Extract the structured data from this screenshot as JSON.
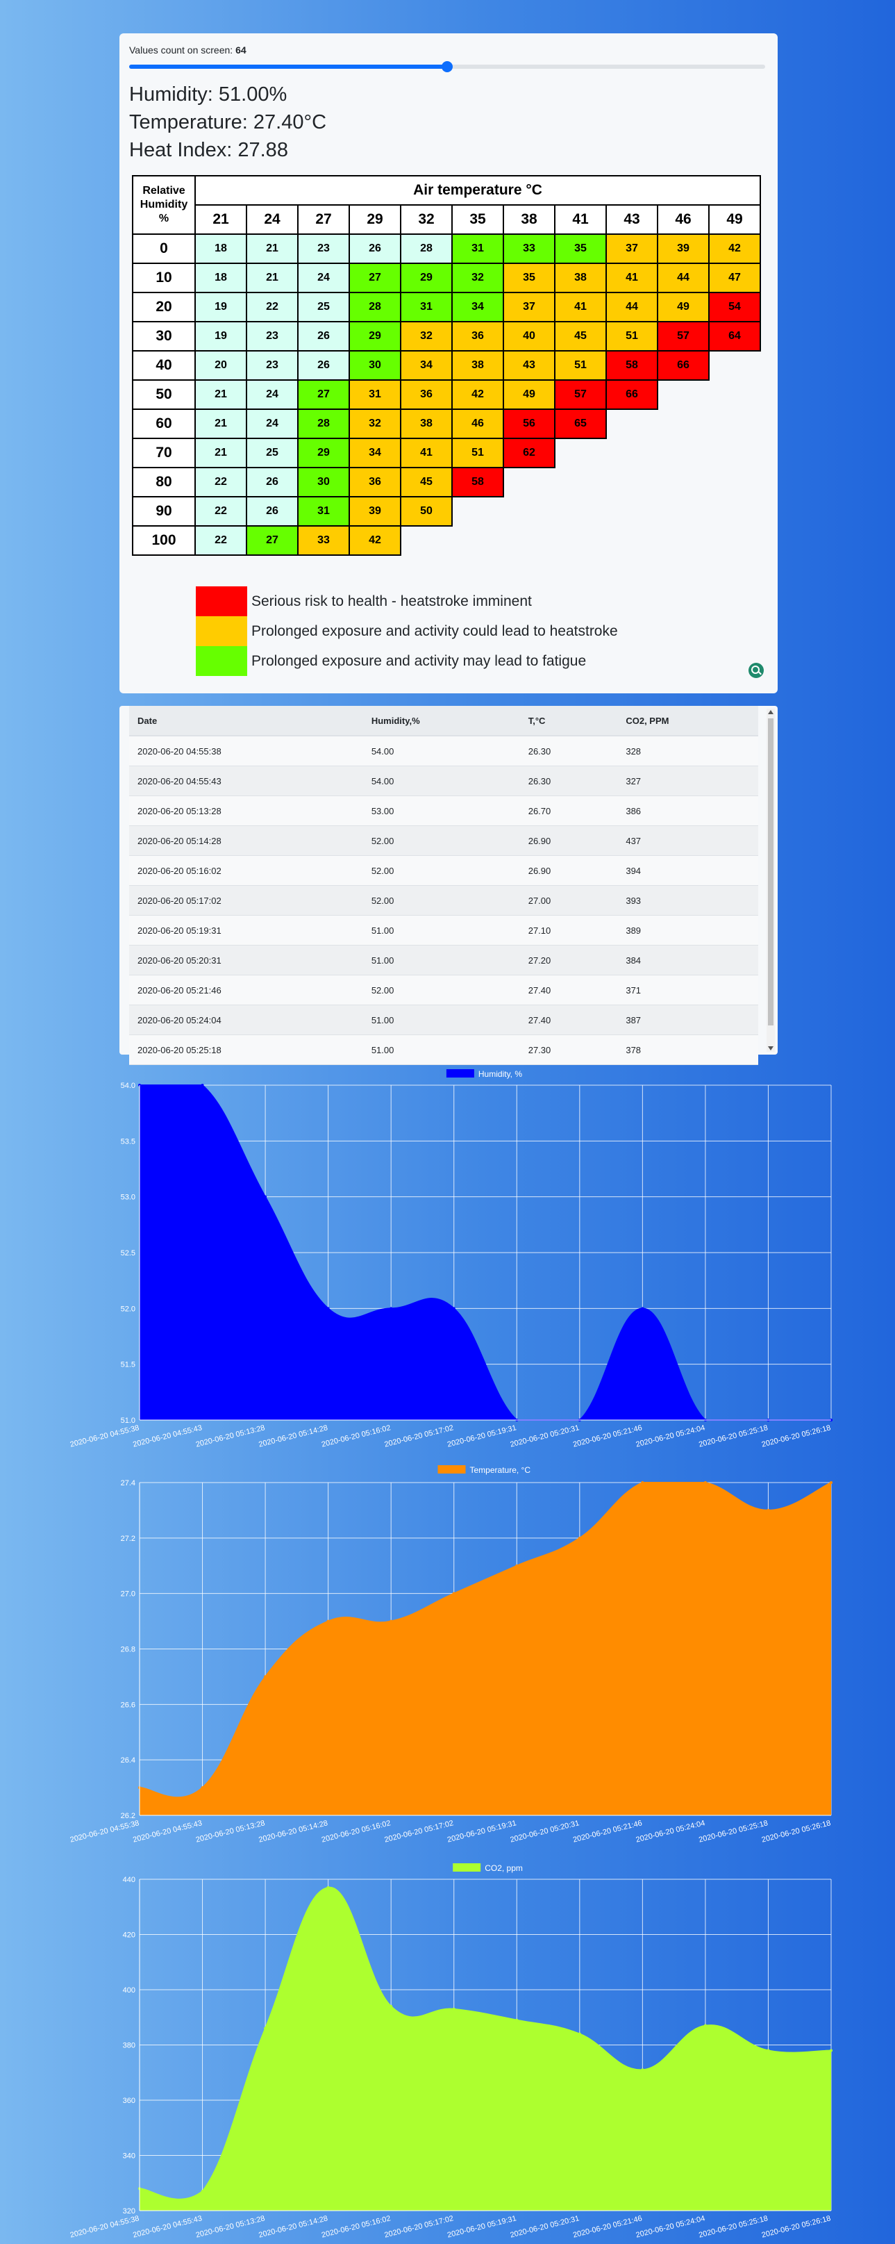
{
  "controls": {
    "count_label": "Values count on screen:",
    "count_value": "64",
    "slider_fraction": 0.5
  },
  "readings": {
    "humidity": "Humidity: 51.00%",
    "temperature": "Temperature: 27.40°C",
    "heat_index": "Heat Index: 27.88"
  },
  "heat_table": {
    "row_header": [
      "Relative",
      "Humidity",
      "%"
    ],
    "col_title": "Air temperature °C",
    "temps": [
      "21",
      "24",
      "27",
      "29",
      "32",
      "35",
      "38",
      "41",
      "43",
      "46",
      "49"
    ],
    "rows": [
      {
        "h": "0",
        "v": [
          "18",
          "21",
          "23",
          "26",
          "28",
          "31",
          "33",
          "35",
          "37",
          "39",
          "42"
        ]
      },
      {
        "h": "10",
        "v": [
          "18",
          "21",
          "24",
          "27",
          "29",
          "32",
          "35",
          "38",
          "41",
          "44",
          "47"
        ]
      },
      {
        "h": "20",
        "v": [
          "19",
          "22",
          "25",
          "28",
          "31",
          "34",
          "37",
          "41",
          "44",
          "49",
          "54"
        ]
      },
      {
        "h": "30",
        "v": [
          "19",
          "23",
          "26",
          "29",
          "32",
          "36",
          "40",
          "45",
          "51",
          "57",
          "64"
        ]
      },
      {
        "h": "40",
        "v": [
          "20",
          "23",
          "26",
          "30",
          "34",
          "38",
          "43",
          "51",
          "58",
          "66"
        ]
      },
      {
        "h": "50",
        "v": [
          "21",
          "24",
          "27",
          "31",
          "36",
          "42",
          "49",
          "57",
          "66"
        ]
      },
      {
        "h": "60",
        "v": [
          "21",
          "24",
          "28",
          "32",
          "38",
          "46",
          "56",
          "65"
        ]
      },
      {
        "h": "70",
        "v": [
          "21",
          "25",
          "29",
          "34",
          "41",
          "51",
          "62"
        ]
      },
      {
        "h": "80",
        "v": [
          "22",
          "26",
          "30",
          "36",
          "45",
          "58"
        ]
      },
      {
        "h": "90",
        "v": [
          "22",
          "26",
          "31",
          "39",
          "50"
        ]
      },
      {
        "h": "100",
        "v": [
          "22",
          "27",
          "33",
          "42"
        ]
      }
    ],
    "levels": [
      "cccccgggyyy",
      "cccgggyyyyy",
      "cccgggyyyyr",
      "cccgyyyyyrr",
      "cccgyyyyrr",
      "ccgyyyyrr",
      "ccgyyyrr",
      "ccgyyyr",
      "ccgyyr",
      "ccgyy",
      "cgyy"
    ],
    "colors": {
      "c": "#d7fff3",
      "g": "#66ff00",
      "y": "#ffcc00",
      "r": "#ff0000"
    }
  },
  "legend": [
    {
      "color": "#ff0000",
      "text": "Serious risk to health - heatstroke imminent"
    },
    {
      "color": "#ffcc00",
      "text": "Prolonged exposure and activity could lead to heatstroke"
    },
    {
      "color": "#66ff00",
      "text": "Prolonged exposure and activity may lead to fatigue"
    }
  ],
  "data_table": {
    "headers": [
      "Date",
      "Humidity,%",
      "T,°C",
      "CO2, PPM"
    ],
    "rows": [
      [
        "2020-06-20 04:55:38",
        "54.00",
        "26.30",
        "328"
      ],
      [
        "2020-06-20 04:55:43",
        "54.00",
        "26.30",
        "327"
      ],
      [
        "2020-06-20 05:13:28",
        "53.00",
        "26.70",
        "386"
      ],
      [
        "2020-06-20 05:14:28",
        "52.00",
        "26.90",
        "437"
      ],
      [
        "2020-06-20 05:16:02",
        "52.00",
        "26.90",
        "394"
      ],
      [
        "2020-06-20 05:17:02",
        "52.00",
        "27.00",
        "393"
      ],
      [
        "2020-06-20 05:19:31",
        "51.00",
        "27.10",
        "389"
      ],
      [
        "2020-06-20 05:20:31",
        "51.00",
        "27.20",
        "384"
      ],
      [
        "2020-06-20 05:21:46",
        "52.00",
        "27.40",
        "371"
      ],
      [
        "2020-06-20 05:24:04",
        "51.00",
        "27.40",
        "387"
      ],
      [
        "2020-06-20 05:25:18",
        "51.00",
        "27.30",
        "378"
      ]
    ]
  },
  "chart_data": [
    {
      "type": "area",
      "legend": "Humidity, %",
      "color": "#0000ff",
      "x": [
        "2020-06-20 04:55:38",
        "2020-06-20 04:55:43",
        "2020-06-20 05:13:28",
        "2020-06-20 05:14:28",
        "2020-06-20 05:16:02",
        "2020-06-20 05:17:02",
        "2020-06-20 05:19:31",
        "2020-06-20 05:20:31",
        "2020-06-20 05:21:46",
        "2020-06-20 05:24:04",
        "2020-06-20 05:25:18",
        "2020-06-20 05:26:18"
      ],
      "values": [
        54,
        54,
        53,
        52,
        52,
        52,
        51,
        51,
        52,
        51,
        51,
        51
      ],
      "ylim": [
        51,
        54
      ],
      "yticks": [
        "54.0",
        "53.5",
        "53.0",
        "52.5",
        "52.0",
        "51.5",
        "51.0"
      ],
      "yvals": [
        54,
        53.5,
        53,
        52.5,
        52,
        51.5,
        51
      ],
      "grid": true
    },
    {
      "type": "area",
      "legend": "Temperature, °C",
      "color": "#ff8c00",
      "x": [
        "2020-06-20 04:55:38",
        "2020-06-20 04:55:43",
        "2020-06-20 05:13:28",
        "2020-06-20 05:14:28",
        "2020-06-20 05:16:02",
        "2020-06-20 05:17:02",
        "2020-06-20 05:19:31",
        "2020-06-20 05:20:31",
        "2020-06-20 05:21:46",
        "2020-06-20 05:24:04",
        "2020-06-20 05:25:18",
        "2020-06-20 05:26:18"
      ],
      "values": [
        26.3,
        26.3,
        26.7,
        26.9,
        26.9,
        27.0,
        27.1,
        27.2,
        27.4,
        27.4,
        27.3,
        27.4
      ],
      "ylim": [
        26.2,
        27.4
      ],
      "yticks": [
        "27.4",
        "27.2",
        "27.0",
        "26.8",
        "26.6",
        "26.4",
        "26.2"
      ],
      "yvals": [
        27.4,
        27.2,
        27.0,
        26.8,
        26.6,
        26.4,
        26.2
      ],
      "grid": true
    },
    {
      "type": "area",
      "legend": "CO2, ppm",
      "color": "#adff2f",
      "x": [
        "2020-06-20 04:55:38",
        "2020-06-20 04:55:43",
        "2020-06-20 05:13:28",
        "2020-06-20 05:14:28",
        "2020-06-20 05:16:02",
        "2020-06-20 05:17:02",
        "2020-06-20 05:19:31",
        "2020-06-20 05:20:31",
        "2020-06-20 05:21:46",
        "2020-06-20 05:24:04",
        "2020-06-20 05:25:18",
        "2020-06-20 05:26:18"
      ],
      "values": [
        328,
        327,
        386,
        437,
        394,
        393,
        389,
        384,
        371,
        387,
        378,
        378
      ],
      "ylim": [
        320,
        440
      ],
      "yticks": [
        "440",
        "420",
        "400",
        "380",
        "360",
        "340",
        "320"
      ],
      "yvals": [
        440,
        420,
        400,
        380,
        360,
        340,
        320
      ],
      "grid": true
    }
  ]
}
